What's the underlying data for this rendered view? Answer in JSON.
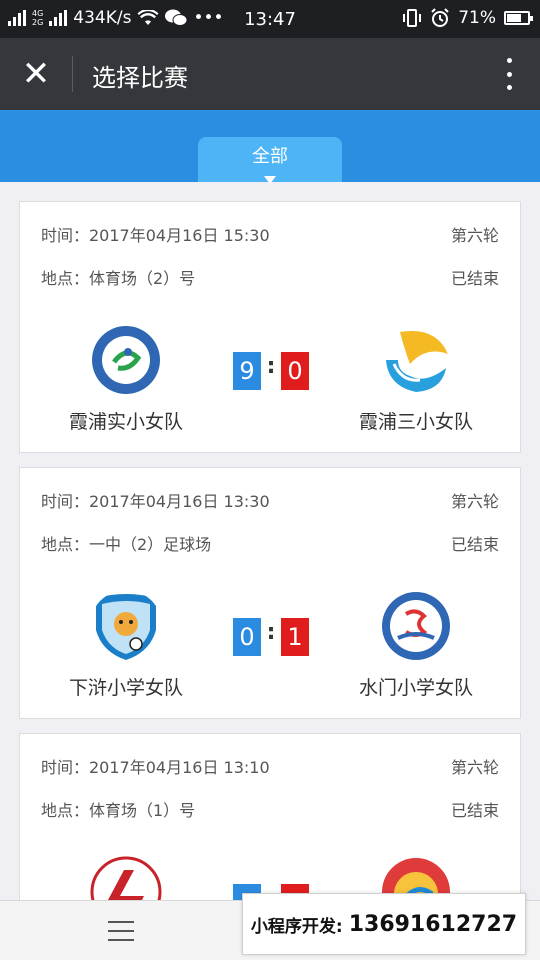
{
  "status_bar": {
    "network_top": "2G",
    "network_mid": "4G",
    "network_bot": "2G",
    "speed": "434K/s",
    "more": "•••",
    "time": "13:47",
    "battery": "71%",
    "battery_level": 0.71
  },
  "nav": {
    "close_glyph": "✕",
    "title": "选择比赛"
  },
  "tabs": {
    "active": "全部"
  },
  "matches": [
    {
      "time": "时间：2017年04月16日 15:30",
      "round": "第六轮",
      "venue": "地点：体育场（2）号",
      "status": "已结束",
      "home_score": "9",
      "away_score": "0",
      "colon": ":",
      "home_team": "霞浦实小女队",
      "away_team": "霞浦三小女队"
    },
    {
      "time": "时间：2017年04月16日 13:30",
      "round": "第六轮",
      "venue": "地点：一中（2）足球场",
      "status": "已结束",
      "home_score": "0",
      "away_score": "1",
      "colon": ":",
      "home_team": "下浒小学女队",
      "away_team": "水门小学女队"
    },
    {
      "time": "时间：2017年04月16日 13:10",
      "round": "第六轮",
      "venue": "地点：体育场（1）号",
      "status": "已结束",
      "home_score": "",
      "away_score": "",
      "colon": "",
      "home_team": "",
      "away_team": ""
    }
  ],
  "promo": {
    "label": "小程序开发:",
    "phone": "13691612727"
  },
  "colors": {
    "tab_bar": "#2a8fe0",
    "tab_active": "#4db4f5",
    "home_score": "#2b8be1",
    "away_score": "#e11c1c"
  }
}
